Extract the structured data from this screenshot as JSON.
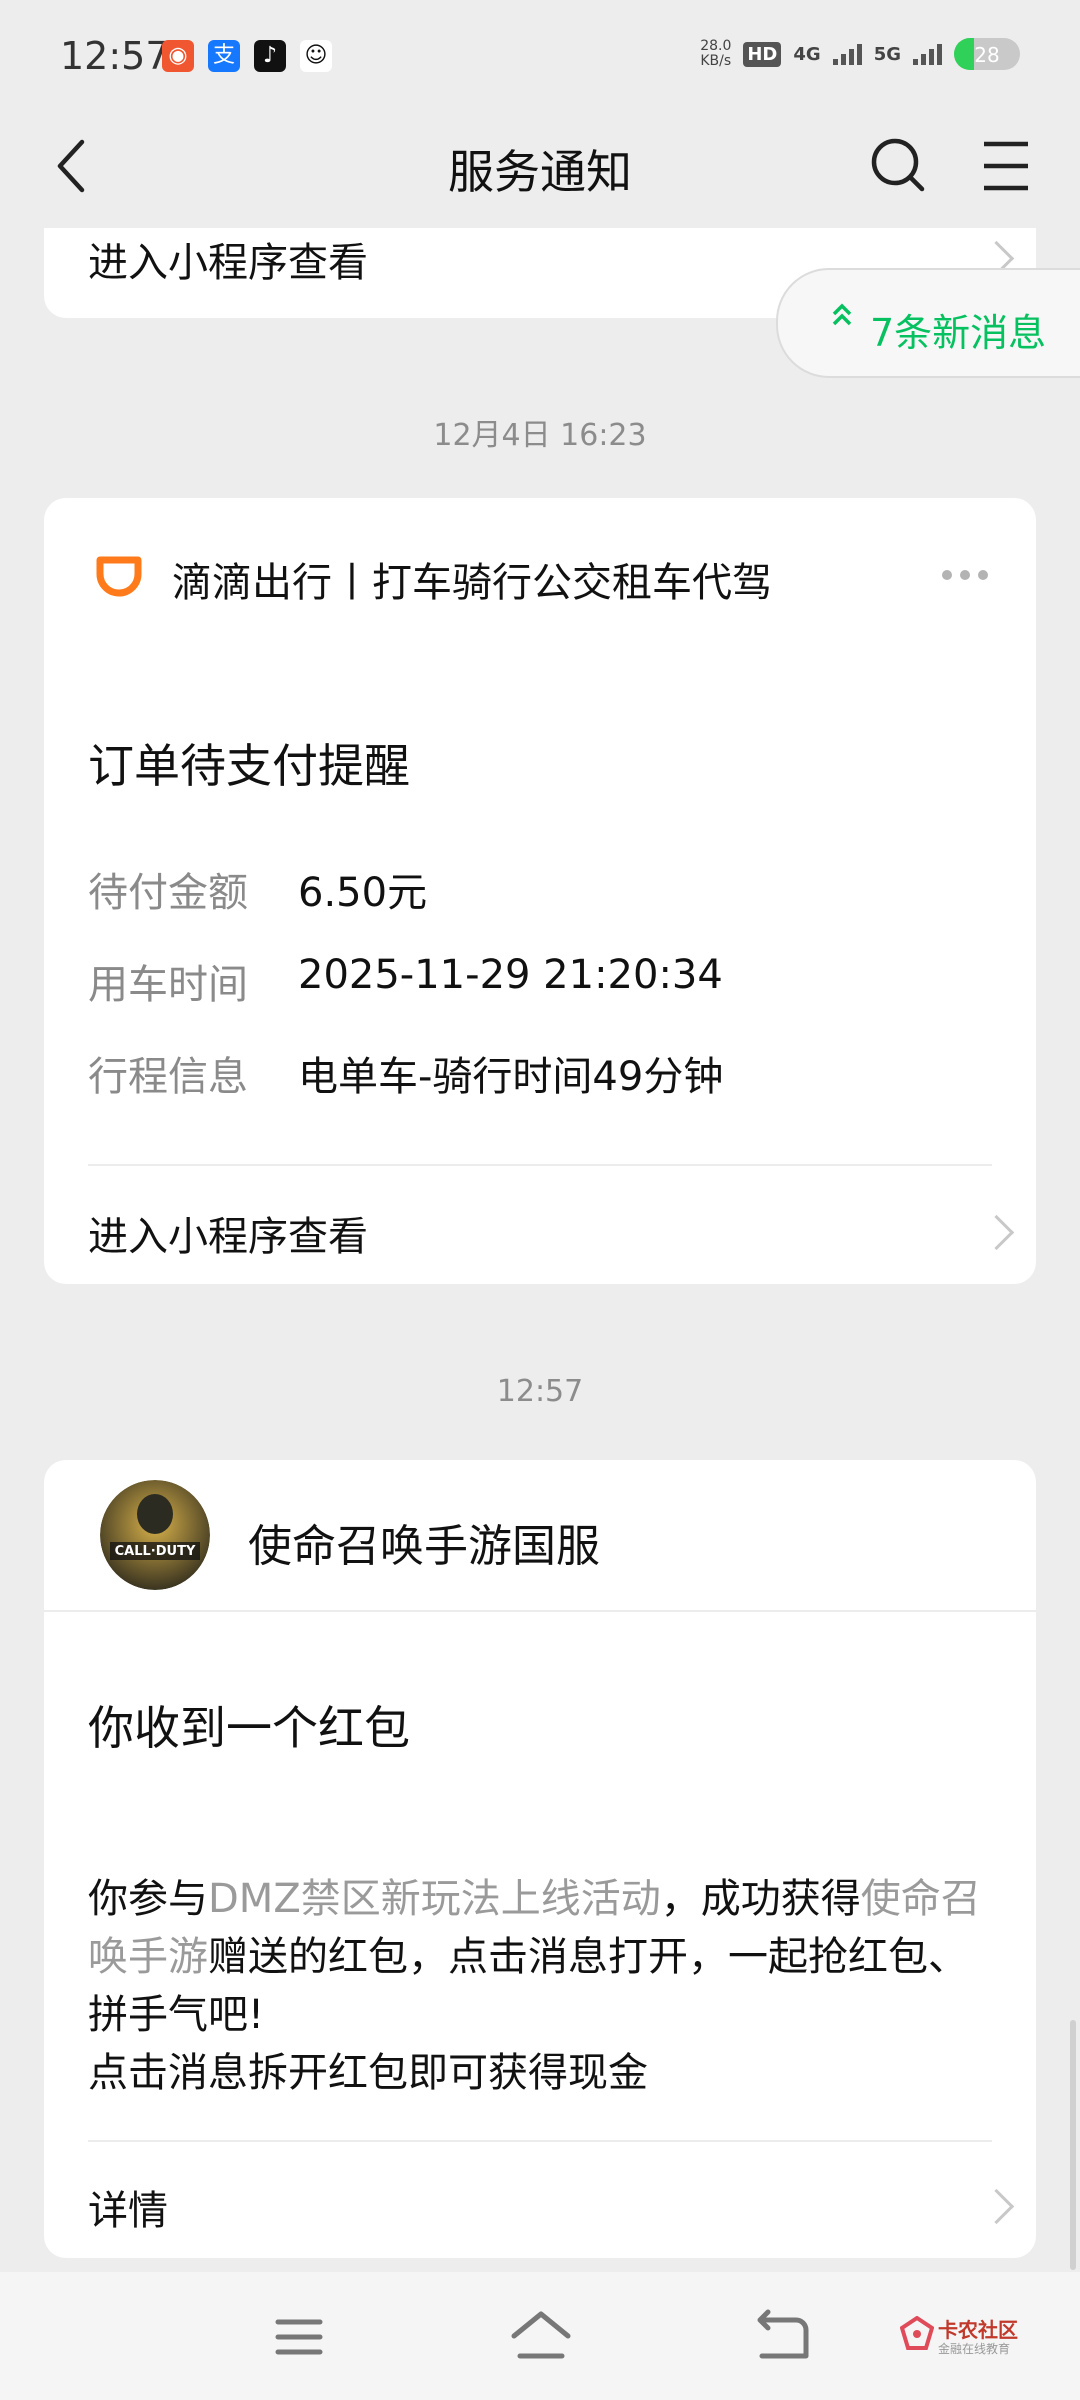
{
  "status_bar": {
    "time": "12:57",
    "app_icons": [
      "taobao-icon",
      "alipay-icon",
      "douyin-icon",
      "qq-icon"
    ],
    "net_speed_value": "28.0",
    "net_speed_unit": "KB/s",
    "hd_badge": "HD",
    "network_1": "4G",
    "network_2": "5G",
    "battery": "28"
  },
  "nav": {
    "title": "服务通知",
    "back_icon": "back-arrow-icon",
    "search_icon": "search-icon",
    "menu_icon": "menu-icon"
  },
  "top_card": {
    "link": "进入小程序查看"
  },
  "new_messages": {
    "label": "7条新消息"
  },
  "messages": [
    {
      "timestamp": "12月4日 16:23",
      "sender": "滴滴出行丨打车骑行公交租车代驾",
      "title": "订单待支付提醒",
      "rows": [
        {
          "label": "待付金额",
          "value": "6.50元"
        },
        {
          "label": "用车时间",
          "value": "2025-11-29 21:20:34"
        },
        {
          "label": "行程信息",
          "value": "电单车-骑行时间49分钟"
        }
      ],
      "link": "进入小程序查看"
    },
    {
      "timestamp": "12:57",
      "sender": "使命召唤手游国服",
      "title": "你收到一个红包",
      "body_part1": "你参与",
      "body_highlight1": "DMZ禁区新玩法上线活动",
      "body_part2": "，成功获得",
      "body_highlight2": "使命召唤手游",
      "body_part3": "赠送的红包，点击消息打开，一起抢红包、拼手气吧!",
      "body_line2": "点击消息拆开红包即可获得现金",
      "link": "详情"
    }
  ],
  "bottom_nav": {
    "menu": "menu-lines-icon",
    "home": "home-icon",
    "back": "back-return-icon"
  },
  "watermark": {
    "title": "卡农社区",
    "subtitle": "金融在线教育"
  },
  "colors": {
    "accent_green": "#07c160",
    "didi_orange": "#ff7a1a",
    "background": "#ededed"
  }
}
